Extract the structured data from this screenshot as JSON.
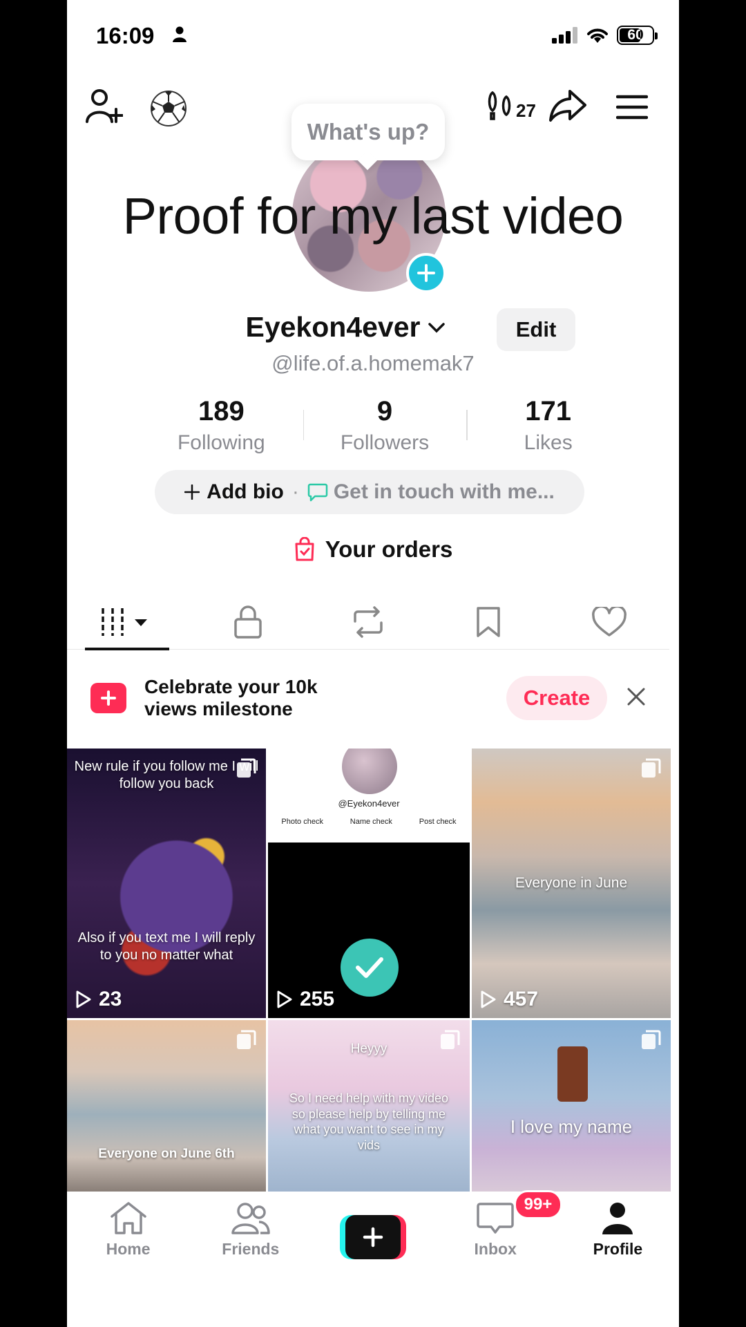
{
  "status_bar": {
    "time": "16:09",
    "battery": "60"
  },
  "header": {
    "whats_up": "What's up?",
    "notifications_count": "27"
  },
  "overlay_caption": "Proof for my last video",
  "profile": {
    "display_name": "Eyekon4ever",
    "handle": "@life.of.a.homemak7",
    "edit_label": "Edit"
  },
  "stats": [
    {
      "value": "189",
      "label": "Following"
    },
    {
      "value": "9",
      "label": "Followers"
    },
    {
      "value": "171",
      "label": "Likes"
    }
  ],
  "bio": {
    "add_label": "Add bio",
    "separator": "·",
    "contact_label": "Get in touch with me..."
  },
  "orders_label": "Your orders",
  "milestone": {
    "line1": "Celebrate your 10k",
    "line2": "views milestone",
    "create_label": "Create"
  },
  "videos": [
    {
      "top_text": "New rule if you follow me I will follow you back",
      "bottom_text": "Also if you text me I will reply to you no matter what",
      "views": "23"
    },
    {
      "handle": "@Eyekon4ever",
      "tabs": [
        "Photo check",
        "Name check",
        "Post check"
      ],
      "views": "255"
    },
    {
      "caption": "Everyone in June",
      "views": "457"
    },
    {
      "caption": "Everyone on June 6th"
    },
    {
      "title": "Heyyy",
      "caption": "So I need help with my video so please help by telling me what you want to see in my vids"
    },
    {
      "caption": "I love my name"
    }
  ],
  "nav": {
    "home": "Home",
    "friends": "Friends",
    "inbox": "Inbox",
    "inbox_badge": "99+",
    "profile": "Profile"
  },
  "colors": {
    "accent": "#fe2c55",
    "cyan": "#25f4ee",
    "add_avatar": "#21c4dd"
  }
}
